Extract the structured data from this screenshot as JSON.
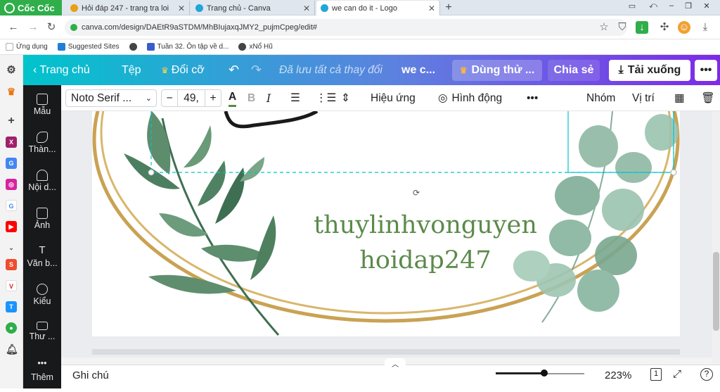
{
  "browser": {
    "brand": "Cốc Cốc",
    "tabs": [
      {
        "title": "Hỏi đáp 247 - trang tra loi",
        "favicon_color": "#e8a014"
      },
      {
        "title": "Trang chủ - Canva",
        "favicon_color": "#20a6d8"
      },
      {
        "title": "we can do it - Logo",
        "favicon_color": "#20a6d8"
      }
    ],
    "url": "canva.com/design/DAEtR9aSTDM/MhBIujaxqJMY2_pujmCpeg/edit#",
    "bookmarks": [
      {
        "label": "Ứng dụng",
        "icon": "apps-grid-icon",
        "color": "#666"
      },
      {
        "label": "Suggested Sites",
        "icon": "bing-icon",
        "color": "#1f7fd6"
      },
      {
        "label": "",
        "icon": "globe-icon",
        "color": "#444"
      },
      {
        "label": "Tuần 32. Ôn tập về d...",
        "icon": "page-icon",
        "color": "#3a5bcf"
      },
      {
        "label": "xNổ Hũ",
        "icon": "globe-icon",
        "color": "#444"
      }
    ]
  },
  "canva": {
    "header": {
      "home": "Trang chủ",
      "file": "Tệp",
      "resize": "Đổi cỡ",
      "saved_status": "Đã lưu tất cả thay đổi",
      "doc_title": "we c...",
      "try_pro": "Dùng thử ...",
      "share": "Chia sẻ",
      "download": "Tải xuống"
    },
    "sidebar": [
      {
        "label": "Mẫu",
        "icon": "template-icon"
      },
      {
        "label": "Thàn...",
        "icon": "elements-icon"
      },
      {
        "label": "Nội d...",
        "icon": "upload-icon"
      },
      {
        "label": "Ảnh",
        "icon": "photo-icon"
      },
      {
        "label": "Văn b...",
        "icon": "text-icon"
      },
      {
        "label": "Kiểu",
        "icon": "palette-icon"
      },
      {
        "label": "Thư ...",
        "icon": "folder-icon"
      },
      {
        "label": "Thêm",
        "icon": "more-icon"
      }
    ],
    "toolbar": {
      "font": "Noto Serif ...",
      "font_size": "49,",
      "effects": "Hiệu ứng",
      "animate": "Hình động",
      "group": "Nhóm",
      "position": "Vị trí"
    },
    "canvas": {
      "line1": "thuylinhvonguyen",
      "line2": "hoidap247",
      "text_color": "#5b8a4a"
    },
    "footer": {
      "notes": "Ghi chú",
      "zoom": "223%",
      "zoom_level": 0.55,
      "page_count": "1"
    }
  }
}
